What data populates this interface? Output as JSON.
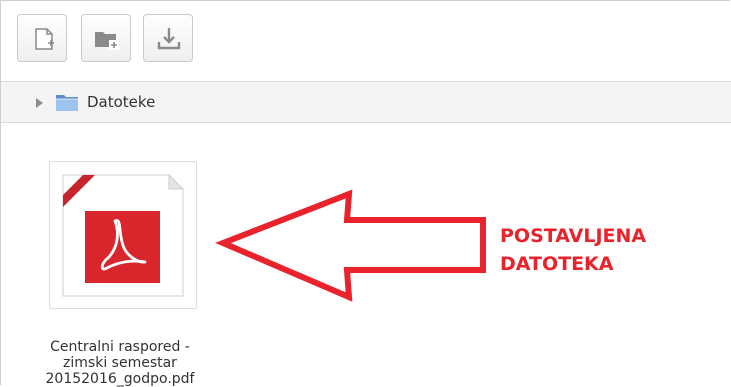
{
  "toolbar": {
    "buttons": [
      {
        "name": "new-file-button",
        "icon": "new-file-icon"
      },
      {
        "name": "new-folder-button",
        "icon": "new-folder-icon"
      },
      {
        "name": "download-button",
        "icon": "download-icon"
      }
    ]
  },
  "path": {
    "expand_icon": "triangle-right-icon",
    "folder_icon": "folder-icon",
    "label": "Datoteke"
  },
  "file": {
    "icon": "pdf-file-icon",
    "name_lines": [
      "Centralni raspored -",
      "zimski semestar",
      "20152016_godpo.pdf"
    ]
  },
  "annotation": {
    "lines": [
      "POSTAVLJENA",
      "DATOTEKA"
    ],
    "color": "#e8232b"
  },
  "colors": {
    "pdf_red": "#d8262c",
    "folder_blue": "#7fb3e6"
  }
}
